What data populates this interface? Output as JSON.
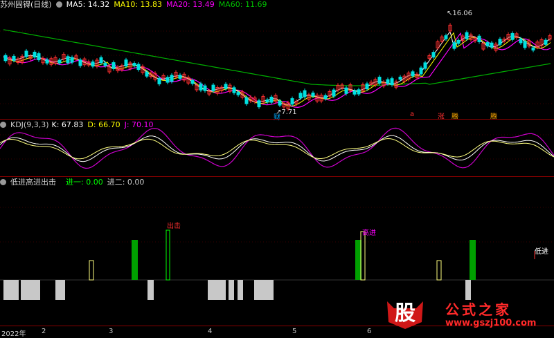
{
  "main_panel": {
    "stock_name": "苏州固锝(日线)",
    "ma": [
      {
        "label": "MA5: 14.32",
        "color": "#ffffff"
      },
      {
        "label": "MA10: 13.83",
        "color": "#ffff00"
      },
      {
        "label": "MA20: 13.49",
        "color": "#ff00ff"
      },
      {
        "label": "MA60: 11.69",
        "color": "#00c000"
      }
    ],
    "high_label": "16.06",
    "low_label": "7.71",
    "markers": [
      {
        "text": "财",
        "color": "#00aaff"
      },
      {
        "text": "a",
        "color": "#ff3030"
      },
      {
        "text": "涨",
        "color": "#ff3030"
      },
      {
        "text": "腾",
        "color": "#ffaa00"
      },
      {
        "text": "腾",
        "color": "#ffaa00"
      }
    ]
  },
  "kdj_panel": {
    "title": "KDJ(9,3,3)",
    "k": "K: 67.83",
    "d": "D: 66.70",
    "j": "J: 70.10"
  },
  "signal_panel": {
    "title": "低进高进出击",
    "in1": "进一: 0.00",
    "in2": "进二: 0.00",
    "labels": {
      "out": "出击",
      "high": "高进",
      "low": "低进"
    }
  },
  "dates": [
    "2022年",
    "2",
    "3",
    "4",
    "5",
    "6"
  ],
  "watermark": {
    "badge": "股",
    "title": "公式之家",
    "url": "www.gszj100.com"
  }
}
